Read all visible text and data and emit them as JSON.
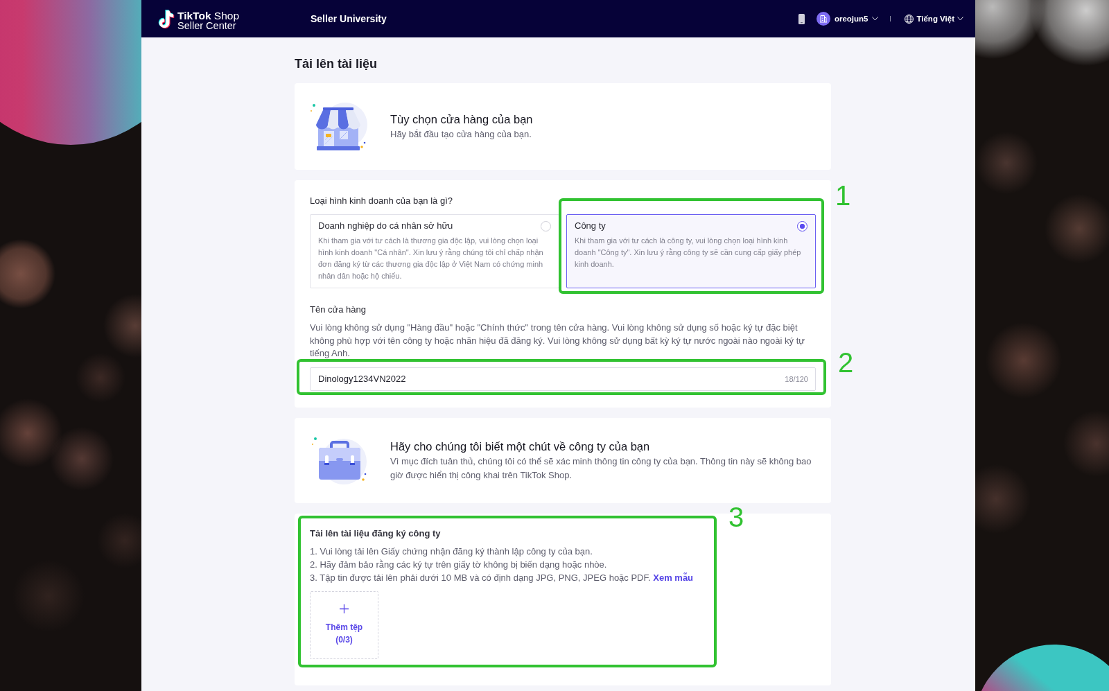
{
  "header": {
    "logo_title": "**TikTok** Shop",
    "logo_subtitle": "Seller Center",
    "nav_link": "Seller University",
    "user_name": "oreojun5",
    "language": "Tiếng Việt"
  },
  "page_title": "Tải lên tài liệu",
  "store_intro": {
    "title": "Tùy chọn cửa hàng của bạn",
    "description": "Hãy bắt đầu tạo cửa hàng của bạn."
  },
  "business_type": {
    "question": "Loại hình kinh doanh của bạn là gì?",
    "options": [
      {
        "title": "Doanh nghiệp do cá nhân sở hữu",
        "description": "Khi tham gia với tư cách là thương gia độc lập, vui lòng chọn loại hình kinh doanh \"Cá nhân\". Xin lưu ý rằng chúng tôi chỉ chấp nhận đơn đăng ký từ các thương gia độc lập ở Việt Nam có chứng minh nhân dân hoặc hộ chiếu.",
        "selected": false
      },
      {
        "title": "Công ty",
        "description": "Khi tham gia với tư cách là công ty, vui lòng chọn loại hình kinh doanh \"Công ty\". Xin lưu ý rằng công ty sẽ cần cung cấp giấy phép kinh doanh.",
        "selected": true
      }
    ]
  },
  "store_name": {
    "label": "Tên cửa hàng",
    "hint": "Vui lòng không sử dụng \"Hàng đầu\" hoặc \"Chính thức\" trong tên cửa hàng. Vui lòng không sử dụng số hoặc ký tự đặc biệt không phù hợp với tên công ty hoặc nhãn hiệu đã đăng ký. Vui lòng không sử dụng bất kỳ ký tự nước ngoài nào ngoài ký tự tiếng Anh.",
    "value": "Dinology1234VN2022",
    "counter": "18/120"
  },
  "company_intro": {
    "title": "Hãy cho chúng tôi biết một chút về công ty của bạn",
    "description": "Vì mục đích tuân thủ, chúng tôi có thể sẽ xác minh thông tin công ty của bạn. Thông tin này sẽ không bao giờ được hiển thị công khai trên TikTok Shop."
  },
  "registration_upload": {
    "title": "Tải lên tài liệu đăng ký công ty",
    "instructions": [
      {
        "text": "1. Vui lòng tải lên Giấy chứng nhận đăng ký thành lập công ty của bạn."
      },
      {
        "text": "2. Hãy đảm bảo rằng các ký tự trên giấy tờ không bị biến dạng hoặc nhòe."
      },
      {
        "text": "3. Tập tin được tải lên phải dưới 10 MB và có định dạng JPG, PNG, JPEG hoặc PDF.",
        "link": "Xem mẫu"
      }
    ],
    "upload_button": {
      "label": "Thêm tệp",
      "count": "(0/3)"
    }
  },
  "annotations": [
    {
      "label": "1"
    },
    {
      "label": "2"
    },
    {
      "label": "3"
    }
  ]
}
